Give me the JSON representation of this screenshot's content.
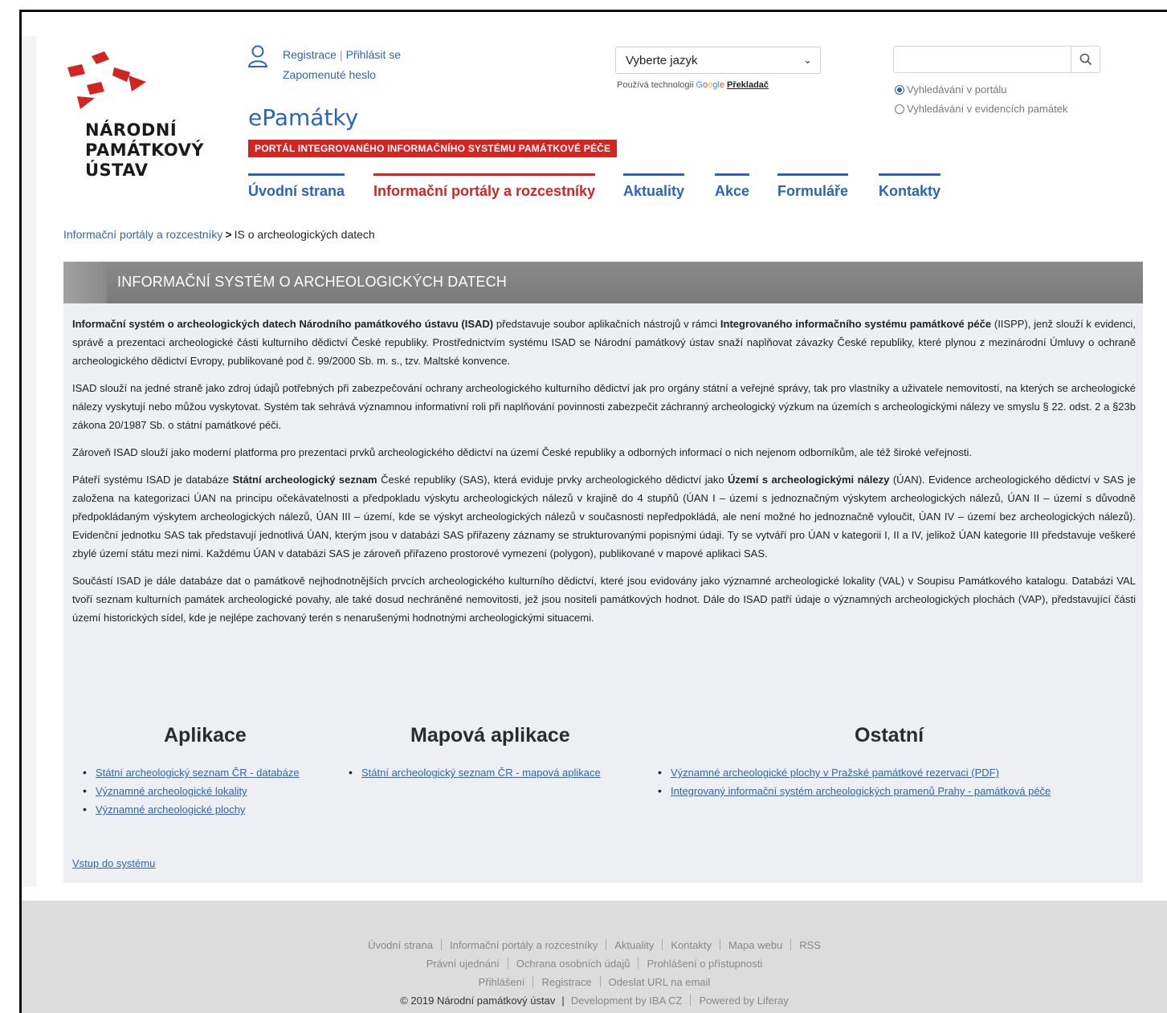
{
  "header": {
    "logo_lines": [
      "NÁRODNÍ",
      "PAMÁTKOVÝ",
      "ÚSTAV"
    ],
    "user": {
      "register": "Registrace",
      "login": "Přihlásit se",
      "forgot": "Zapomenuté heslo"
    },
    "site_title": "ePamátky",
    "portal_banner": "PORTÁL INTEGROVANÉHO INFORMAČNÍHO SYSTÉMU PAMÁTKOVÉ PÉČE",
    "language_select": {
      "value": "Vyberte jazyk"
    },
    "translate": {
      "prefix": "Používá technologii",
      "brand": "Google",
      "link": "Překladač"
    },
    "search": {
      "placeholder": "",
      "options": [
        {
          "label": "Vyhledávání v portálu",
          "selected": true
        },
        {
          "label": "Vyhledávání v evidencích památek",
          "selected": false
        }
      ]
    }
  },
  "nav": {
    "items": [
      {
        "label": "Úvodní strana",
        "active": false
      },
      {
        "label": "Informační portály a rozcestníky",
        "active": true
      },
      {
        "label": "Aktuality",
        "active": false
      },
      {
        "label": "Akce",
        "active": false
      },
      {
        "label": "Formuláře",
        "active": false
      },
      {
        "label": "Kontakty",
        "active": false
      }
    ]
  },
  "breadcrumb": {
    "parent": "Informační portály a rozcestníky",
    "separator": ">",
    "current": "IS o archeologických datech"
  },
  "content": {
    "title": "INFORMAČNÍ SYSTÉM O ARCHEOLOGICKÝCH DATECH",
    "p1": {
      "b1": "Informační systém o archeologických datech Národního památkového ústavu (ISAD)",
      "t1": " představuje soubor aplikačních nástrojů v rámci ",
      "b2": "Integrovaného informačního systému památkové péče",
      "t2": " (IISPP), jenž slouží k evidenci, správě a prezentaci archeologické části kulturního dědictví České republiky. Prostřednictvím systému ISAD se Národní památkový ústav snaží naplňovat závazky České republiky, které plynou z mezinárodní Úmluvy o ochraně archeologického dědictví Evropy, publikované pod č. 99/2000 Sb. m. s., tzv. Maltské konvence."
    },
    "p2": "ISAD slouží na jedné straně jako zdroj údajů potřebných při zabezpečování ochrany archeologického kulturního dědictví jak pro orgány státní a veřejné správy, tak pro vlastníky a uživatele nemovitostí, na kterých se archeologické nálezy vyskytují nebo můžou vyskytovat. Systém tak sehrává významnou informativní roli při naplňování povinnosti zabezpečit záchranný archeologický výzkum na územích s archeologickými nálezy ve smyslu § 22. odst. 2 a §23b zákona 20/1987 Sb. o státní památkové péči.",
    "p3": "Zároveň ISAD slouží jako moderní platforma pro prezentaci prvků archeologického dědictví na území České republiky a odborných informací o nich nejenom odborníkům, ale též široké veřejnosti.",
    "p4": {
      "t1": "Páteří systému ISAD je databáze ",
      "b1": "Státní archeologický seznam",
      "t2": " České republiky (SAS), která eviduje prvky archeologického dědictví jako ",
      "b2": "Území s archeologickými nálezy",
      "t3": " (ÚAN). Evidence archeologického dědictví v SAS je založena na kategorizaci ÚAN na principu očekávatelnosti a předpokladu výskytu archeologických nálezů v krajině do 4 stupňů (ÚAN I – území s jednoznačným výskytem archeologických nálezů, ÚAN II – území s důvodně předpokládaným výskytem archeologických nálezů, ÚAN III – území, kde se výskyt archeologických nálezů v současnosti nepředpokládá, ale není možné ho jednoznačně vyloučit, ÚAN IV – území bez archeologických nálezů). Evidenční jednotku SAS tak představují jednotlivá ÚAN, kterým jsou v databázi SAS přiřazeny záznamy se strukturovanými popisnými údaji. Ty se vytváří pro ÚAN v kategorii I, II a IV, jelikož ÚAN kategorie III představuje veškeré zbylé území státu mezi nimi. Každému ÚAN v databázi SAS je zároveň přiřazeno prostorové vymezení (polygon), publikované v mapové aplikaci SAS."
    },
    "p5": "Součástí ISAD je dále databáze dat o památkově nejhodnotnějších prvcích archeologického kulturního dědictví, které jsou evidovány jako významné archeologické lokality (VAL) v Soupisu Památkového katalogu. Databázi VAL tvoří seznam kulturních památek archeologické povahy, ale také dosud nechráněné nemovitosti, jež jsou nositeli památkových hodnot. Dále do ISAD patří údaje o významných archeologických plochách (VAP), představující části území historických sídel, kde je nejlépe zachovaný terén s nenarušenými hodnotnými archeologickými situacemi.",
    "sections": {
      "apps": {
        "heading": "Aplikace",
        "links": [
          "Státní archeologický seznam ČR - databáze",
          "Významné archeologické lokality",
          "Významné archeologické plochy"
        ]
      },
      "map": {
        "heading": "Mapová aplikace",
        "links": [
          "Státní archeologický seznam ČR - mapová aplikace"
        ]
      },
      "other": {
        "heading": "Ostatní",
        "links": [
          "Významné archeologické plochy v Pražské památkové rezervaci (PDF)",
          "Integrovaný informační systém archeologických pramenů Prahy - památková péče"
        ]
      }
    },
    "enter_link": "Vstup do systému"
  },
  "footer": {
    "row1": [
      "Úvodní strana",
      "Informační portály a rozcestníky",
      "Aktuality",
      "Kontakty",
      "Mapa webu",
      "RSS"
    ],
    "row2": [
      "Právní ujednání",
      "Ochrana osobních údajů",
      "Prohlášení o přístupnosti"
    ],
    "row3": [
      "Přihlášení",
      "Registrace",
      "Odeslat URL na email"
    ],
    "copyright": "© 2019 Národní památkový ústav",
    "divider": "|",
    "row4": [
      "Development by IBA CZ",
      "Powered by Liferay"
    ]
  },
  "colors": {
    "link_blue": "#2a66b8",
    "accent_red": "#d32424",
    "header_grey": "#7f7f7f",
    "panel_bg": "#eeeff2",
    "footer_bg": "#dcdcdc"
  }
}
